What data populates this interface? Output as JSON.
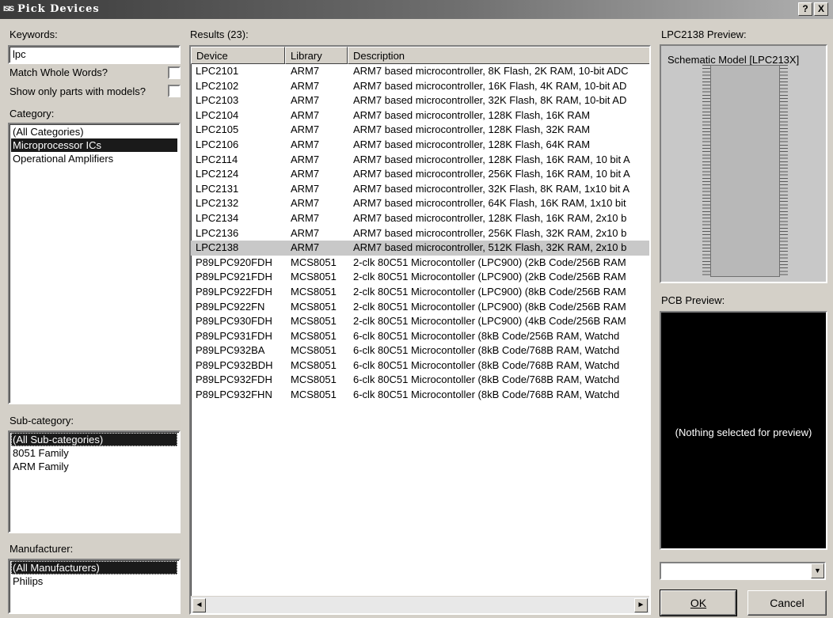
{
  "window": {
    "icon_text": "ISIS",
    "title": "Pick Devices",
    "help_btn": "?",
    "close_btn": "X"
  },
  "keywords": {
    "label": "Keywords:",
    "value": "lpc"
  },
  "match_whole_words": {
    "label": "Match Whole Words?",
    "checked": false
  },
  "show_only_models": {
    "label": "Show only parts with models?",
    "checked": false
  },
  "category": {
    "label": "Category:",
    "items": [
      "(All Categories)",
      "Microprocessor ICs",
      "Operational Amplifiers"
    ],
    "selected": "Microprocessor ICs"
  },
  "subcategory": {
    "label": "Sub-category:",
    "items": [
      "(All Sub-categories)",
      "8051 Family",
      "ARM Family"
    ],
    "selected": "(All Sub-categories)"
  },
  "manufacturer": {
    "label": "Manufacturer:",
    "items": [
      "(All Manufacturers)",
      "Philips"
    ],
    "selected": "(All Manufacturers)"
  },
  "results": {
    "label": "Results (23):",
    "columns": [
      "Device",
      "Library",
      "Description"
    ],
    "selected_device": "LPC2138",
    "rows": [
      [
        "LPC2101",
        "ARM7",
        "ARM7 based microcontroller, 8K Flash, 2K RAM, 10-bit ADC"
      ],
      [
        "LPC2102",
        "ARM7",
        "ARM7 based microcontroller, 16K Flash, 4K RAM, 10-bit AD"
      ],
      [
        "LPC2103",
        "ARM7",
        "ARM7 based microcontroller, 32K Flash, 8K RAM, 10-bit AD"
      ],
      [
        "LPC2104",
        "ARM7",
        "ARM7 based microcontroller, 128K Flash, 16K RAM"
      ],
      [
        "LPC2105",
        "ARM7",
        "ARM7 based microcontroller, 128K Flash, 32K RAM"
      ],
      [
        "LPC2106",
        "ARM7",
        "ARM7 based microcontroller, 128K Flash, 64K RAM"
      ],
      [
        "LPC2114",
        "ARM7",
        "ARM7 based microcontroller, 128K Flash, 16K RAM, 10 bit A"
      ],
      [
        "LPC2124",
        "ARM7",
        "ARM7 based microcontroller, 256K Flash, 16K RAM, 10 bit A"
      ],
      [
        "LPC2131",
        "ARM7",
        "ARM7 based microcontroller, 32K Flash, 8K RAM, 1x10 bit A"
      ],
      [
        "LPC2132",
        "ARM7",
        "ARM7 based microcontroller, 64K Flash, 16K RAM, 1x10 bit"
      ],
      [
        "LPC2134",
        "ARM7",
        "ARM7 based microcontroller, 128K Flash, 16K RAM, 2x10 b"
      ],
      [
        "LPC2136",
        "ARM7",
        "ARM7 based microcontroller, 256K Flash, 32K RAM, 2x10 b"
      ],
      [
        "LPC2138",
        "ARM7",
        "ARM7 based microcontroller, 512K Flash, 32K RAM, 2x10 b"
      ],
      [
        "P89LPC920FDH",
        "MCS8051",
        "2-clk 80C51 Microcontoller (LPC900) (2kB Code/256B RAM"
      ],
      [
        "P89LPC921FDH",
        "MCS8051",
        "2-clk 80C51 Microcontoller (LPC900) (2kB Code/256B RAM"
      ],
      [
        "P89LPC922FDH",
        "MCS8051",
        "2-clk 80C51 Microcontoller (LPC900) (8kB Code/256B RAM"
      ],
      [
        "P89LPC922FN",
        "MCS8051",
        "2-clk 80C51 Microcontoller (LPC900) (8kB Code/256B RAM"
      ],
      [
        "P89LPC930FDH",
        "MCS8051",
        "2-clk 80C51 Microcontoller (LPC900) (4kB Code/256B RAM"
      ],
      [
        "P89LPC931FDH",
        "MCS8051",
        "6-clk 80C51 Microcontoller (8kB Code/256B RAM, Watchd"
      ],
      [
        "P89LPC932BA",
        "MCS8051",
        "6-clk 80C51 Microcontoller (8kB Code/768B RAM, Watchd"
      ],
      [
        "P89LPC932BDH",
        "MCS8051",
        "6-clk 80C51 Microcontoller (8kB Code/768B RAM, Watchd"
      ],
      [
        "P89LPC932FDH",
        "MCS8051",
        "6-clk 80C51 Microcontoller (8kB Code/768B RAM, Watchd"
      ],
      [
        "P89LPC932FHN",
        "MCS8051",
        "6-clk 80C51 Microcontoller (8kB Code/768B RAM, Watchd"
      ]
    ]
  },
  "schematic_preview": {
    "label": "LPC2138 Preview:",
    "caption": "Schematic Model [LPC213X]"
  },
  "pcb_preview": {
    "label": "PCB Preview:",
    "empty_message": "(Nothing selected for preview)"
  },
  "package_combo": {
    "value": ""
  },
  "buttons": {
    "ok": "OK",
    "cancel": "Cancel"
  },
  "icons": {
    "scroll_left": "◄",
    "scroll_right": "►",
    "combo_arrow": "▼"
  }
}
